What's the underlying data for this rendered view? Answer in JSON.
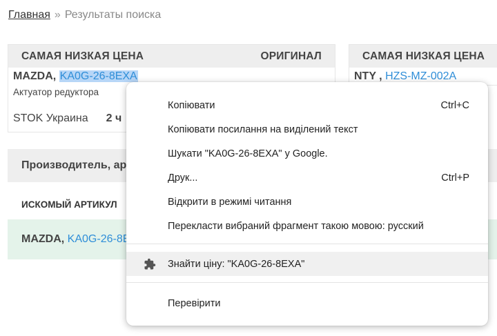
{
  "breadcrumb": {
    "home": "Главная",
    "separator": "»",
    "current": "Результаты поиска"
  },
  "card1": {
    "header_left": "САМАЯ НИЗКАЯ ЦЕНА",
    "header_right": "ОРИГИНАЛ",
    "brand": "MAZDA",
    "comma": ",",
    "article": "KA0G-26-8EXA",
    "description": "Актуатор редуктора",
    "supplier": "STOK Украина",
    "delivery": "2 ч"
  },
  "card2": {
    "header_left": "САМАЯ НИЗКАЯ ЦЕНА",
    "brand": "NTY",
    "comma": " ,",
    "article": "HZS-MZ-002A"
  },
  "results": {
    "header": "Производитель, арт",
    "column_header": "ИСКОМЫЙ АРТИКУЛ",
    "row": {
      "brand": "MAZDA",
      "comma": ",",
      "article": "KA0G-26-8E"
    }
  },
  "context_menu": {
    "items": [
      {
        "label": "Копіювати",
        "shortcut": "Ctrl+C"
      },
      {
        "label": "Копіювати посилання на виділений текст",
        "shortcut": ""
      },
      {
        "label": "Шукати \"KA0G-26-8EXA\" у Google.",
        "shortcut": ""
      },
      {
        "label": "Друк...",
        "shortcut": "Ctrl+P"
      },
      {
        "label": "Відкрити в режимі читання",
        "shortcut": ""
      },
      {
        "label": "Перекласти вибраний фрагмент такою мовою: русский",
        "shortcut": ""
      }
    ],
    "extension_item": {
      "label": "Знайти ціну: \"KA0G-26-8EXA\"",
      "icon": "puzzle-icon"
    },
    "inspect_item": {
      "label": "Перевірити"
    }
  },
  "colors": {
    "link": "#2f8ed8",
    "selection": "#b7d6f7",
    "header_bg": "#eeeeee",
    "row_bg": "#e4f3ea",
    "hover": "#f0f0f0"
  }
}
